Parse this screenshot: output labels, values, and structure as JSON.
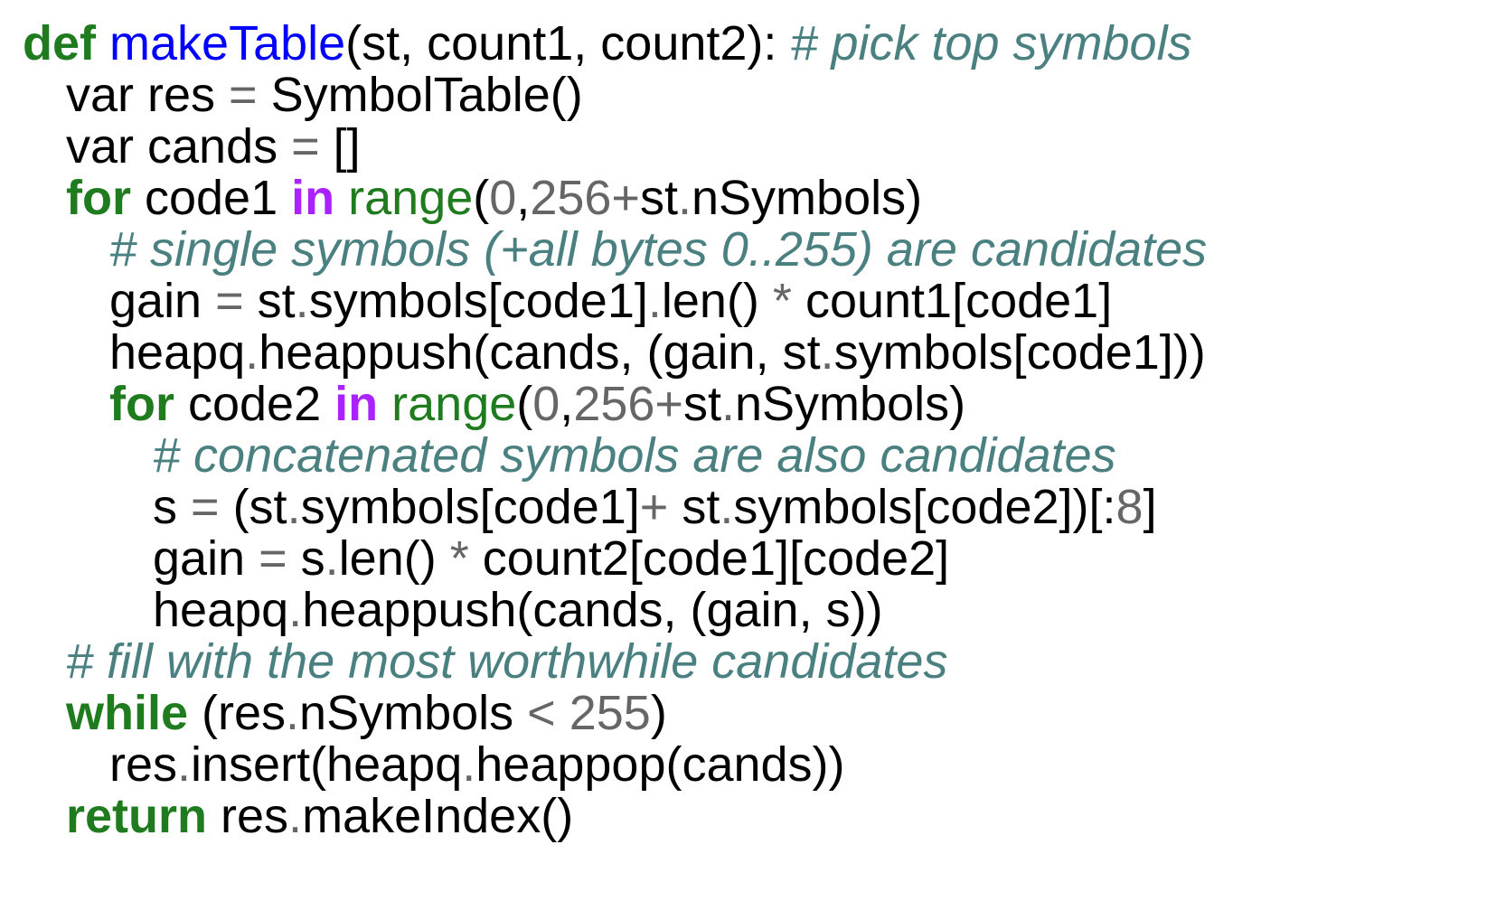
{
  "colors": {
    "keyword": "#1e7b1e",
    "function_name": "#0000ff",
    "builtin": "#1e7b1e",
    "in_keyword": "#aa22ff",
    "comment": "#4a8080",
    "number": "#666666",
    "operator": "#666666",
    "text": "#000000"
  },
  "code_lines": [
    {
      "indent": 0,
      "tokens": [
        {
          "t": "kw",
          "v": "def"
        },
        {
          "t": "id",
          "v": " "
        },
        {
          "t": "fn",
          "v": "makeTable"
        },
        {
          "t": "id",
          "v": "(st, count1, count2): "
        },
        {
          "t": "cm",
          "v": "# pick top symbols"
        }
      ]
    },
    {
      "indent": 1,
      "tokens": [
        {
          "t": "id",
          "v": "var res "
        },
        {
          "t": "op",
          "v": "="
        },
        {
          "t": "id",
          "v": " SymbolTable()"
        }
      ]
    },
    {
      "indent": 1,
      "tokens": [
        {
          "t": "id",
          "v": "var cands "
        },
        {
          "t": "op",
          "v": "="
        },
        {
          "t": "id",
          "v": " []"
        }
      ]
    },
    {
      "indent": 1,
      "tokens": [
        {
          "t": "kw",
          "v": "for"
        },
        {
          "t": "id",
          "v": " code1 "
        },
        {
          "t": "in",
          "v": "in"
        },
        {
          "t": "id",
          "v": " "
        },
        {
          "t": "bi",
          "v": "range"
        },
        {
          "t": "id",
          "v": "("
        },
        {
          "t": "num",
          "v": "0"
        },
        {
          "t": "id",
          "v": ","
        },
        {
          "t": "num",
          "v": "256"
        },
        {
          "t": "op",
          "v": "+"
        },
        {
          "t": "id",
          "v": "st"
        },
        {
          "t": "op",
          "v": "."
        },
        {
          "t": "id",
          "v": "nSymbols)"
        }
      ]
    },
    {
      "indent": 2,
      "tokens": [
        {
          "t": "cm",
          "v": "# single symbols (+all bytes 0..255) are candidates"
        }
      ]
    },
    {
      "indent": 2,
      "tokens": [
        {
          "t": "id",
          "v": "gain "
        },
        {
          "t": "op",
          "v": "="
        },
        {
          "t": "id",
          "v": " st"
        },
        {
          "t": "op",
          "v": "."
        },
        {
          "t": "id",
          "v": "symbols[code1]"
        },
        {
          "t": "op",
          "v": "."
        },
        {
          "t": "id",
          "v": "len() "
        },
        {
          "t": "op",
          "v": "*"
        },
        {
          "t": "id",
          "v": " count1[code1]"
        }
      ]
    },
    {
      "indent": 2,
      "tokens": [
        {
          "t": "id",
          "v": "heapq"
        },
        {
          "t": "op",
          "v": "."
        },
        {
          "t": "id",
          "v": "heappush(cands, (gain, st"
        },
        {
          "t": "op",
          "v": "."
        },
        {
          "t": "id",
          "v": "symbols[code1]))"
        }
      ]
    },
    {
      "indent": 2,
      "tokens": [
        {
          "t": "kw",
          "v": "for"
        },
        {
          "t": "id",
          "v": " code2 "
        },
        {
          "t": "in",
          "v": "in"
        },
        {
          "t": "id",
          "v": " "
        },
        {
          "t": "bi",
          "v": "range"
        },
        {
          "t": "id",
          "v": "("
        },
        {
          "t": "num",
          "v": "0"
        },
        {
          "t": "id",
          "v": ","
        },
        {
          "t": "num",
          "v": "256"
        },
        {
          "t": "op",
          "v": "+"
        },
        {
          "t": "id",
          "v": "st"
        },
        {
          "t": "op",
          "v": "."
        },
        {
          "t": "id",
          "v": "nSymbols)"
        }
      ]
    },
    {
      "indent": 3,
      "tokens": [
        {
          "t": "cm",
          "v": "# concatenated symbols are also candidates"
        }
      ]
    },
    {
      "indent": 3,
      "tokens": [
        {
          "t": "id",
          "v": "s "
        },
        {
          "t": "op",
          "v": "="
        },
        {
          "t": "id",
          "v": " (st"
        },
        {
          "t": "op",
          "v": "."
        },
        {
          "t": "id",
          "v": "symbols[code1]"
        },
        {
          "t": "op",
          "v": "+"
        },
        {
          "t": "id",
          "v": " st"
        },
        {
          "t": "op",
          "v": "."
        },
        {
          "t": "id",
          "v": "symbols[code2])[:"
        },
        {
          "t": "num",
          "v": "8"
        },
        {
          "t": "id",
          "v": "]"
        }
      ]
    },
    {
      "indent": 3,
      "tokens": [
        {
          "t": "id",
          "v": "gain "
        },
        {
          "t": "op",
          "v": "="
        },
        {
          "t": "id",
          "v": " s"
        },
        {
          "t": "op",
          "v": "."
        },
        {
          "t": "id",
          "v": "len() "
        },
        {
          "t": "op",
          "v": "*"
        },
        {
          "t": "id",
          "v": " count2[code1][code2]"
        }
      ]
    },
    {
      "indent": 3,
      "tokens": [
        {
          "t": "id",
          "v": "heapq"
        },
        {
          "t": "op",
          "v": "."
        },
        {
          "t": "id",
          "v": "heappush(cands, (gain, s))"
        }
      ]
    },
    {
      "indent": 1,
      "tokens": [
        {
          "t": "cm",
          "v": "# fill with the most worthwhile candidates"
        }
      ]
    },
    {
      "indent": 1,
      "tokens": [
        {
          "t": "kw",
          "v": "while"
        },
        {
          "t": "id",
          "v": " (res"
        },
        {
          "t": "op",
          "v": "."
        },
        {
          "t": "id",
          "v": "nSymbols "
        },
        {
          "t": "op",
          "v": "<"
        },
        {
          "t": "id",
          "v": " "
        },
        {
          "t": "num",
          "v": "255"
        },
        {
          "t": "id",
          "v": ")"
        }
      ]
    },
    {
      "indent": 2,
      "tokens": [
        {
          "t": "id",
          "v": "res"
        },
        {
          "t": "op",
          "v": "."
        },
        {
          "t": "id",
          "v": "insert(heapq"
        },
        {
          "t": "op",
          "v": "."
        },
        {
          "t": "id",
          "v": "heappop(cands))"
        }
      ]
    },
    {
      "indent": 1,
      "tokens": [
        {
          "t": "kw",
          "v": "return"
        },
        {
          "t": "id",
          "v": " res"
        },
        {
          "t": "op",
          "v": "."
        },
        {
          "t": "id",
          "v": "makeIndex()"
        }
      ]
    }
  ]
}
